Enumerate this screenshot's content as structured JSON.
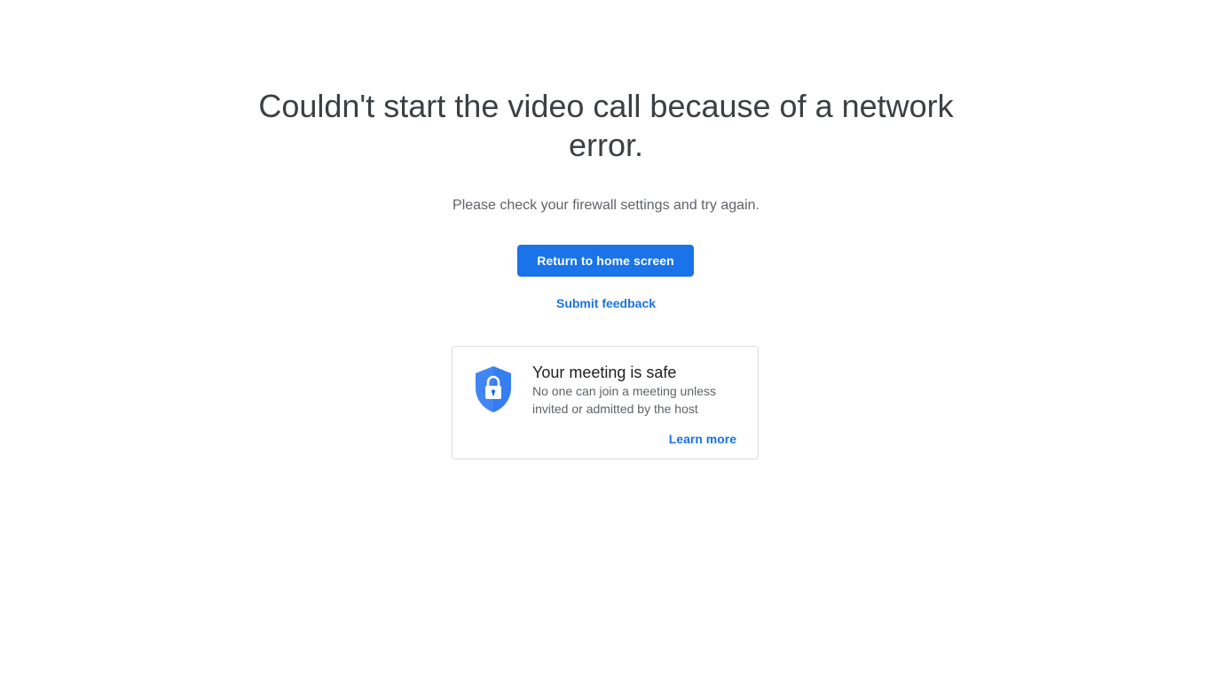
{
  "error": {
    "title": "Couldn't start the video call because of a network error.",
    "message": "Please check your firewall settings and try again."
  },
  "actions": {
    "return_label": "Return to home screen",
    "feedback_label": "Submit feedback"
  },
  "safety_card": {
    "icon": "shield-lock-icon",
    "title": "Your meeting is safe",
    "body": "No one can join a meeting unless invited or admitted by the host",
    "link_label": "Learn more"
  },
  "colors": {
    "accent": "#1a73e8",
    "shield": "#4285f4",
    "title_text": "#3c4043",
    "body_text": "#5f6368",
    "card_border": "#dadce0"
  }
}
